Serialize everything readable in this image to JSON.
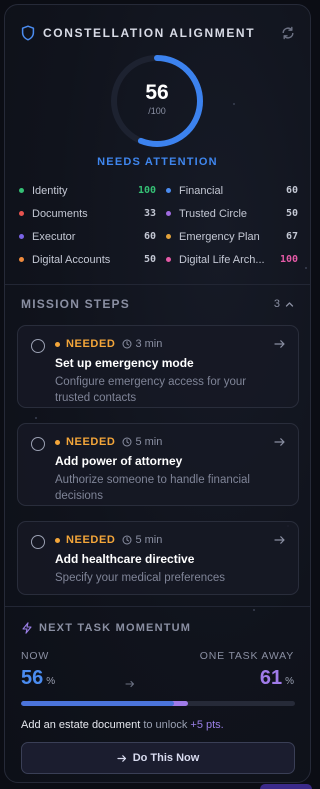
{
  "header": {
    "title": "CONSTELLATION ALIGNMENT",
    "icon": "shield-icon",
    "refresh_icon": "refresh-icon"
  },
  "score": {
    "value": "56",
    "out_of": "/100",
    "fraction": 0.56,
    "status": "NEEDS ATTENTION",
    "color": "#3f86ee"
  },
  "categories": [
    {
      "name": "Identity",
      "value": "100",
      "dot": "#35c075",
      "value_color": "#35c075"
    },
    {
      "name": "Financial",
      "value": "60",
      "dot": "#4b8cf0",
      "value_color": "#c3c7d3"
    },
    {
      "name": "Documents",
      "value": "33",
      "dot": "#e8534f",
      "value_color": "#c3c7d3"
    },
    {
      "name": "Trusted Circle",
      "value": "50",
      "dot": "#a06be0",
      "value_color": "#c3c7d3"
    },
    {
      "name": "Executor",
      "value": "60",
      "dot": "#7a63e6",
      "value_color": "#c3c7d3"
    },
    {
      "name": "Emergency Plan",
      "value": "67",
      "dot": "#e3a23b",
      "value_color": "#c3c7d3"
    },
    {
      "name": "Digital Accounts",
      "value": "50",
      "dot": "#ef8a3c",
      "value_color": "#c3c7d3"
    },
    {
      "name": "Digital Life Arch...",
      "value": "100",
      "dot": "#e55aa7",
      "value_color": "#e55aa7"
    }
  ],
  "mission": {
    "label": "MISSION STEPS",
    "count": "3"
  },
  "steps": [
    {
      "status": "NEEDED",
      "time": "3 min",
      "title": "Set up emergency mode",
      "desc": "Configure emergency access for your trusted contacts"
    },
    {
      "status": "NEEDED",
      "time": "5 min",
      "title": "Add power of attorney",
      "desc": "Authorize someone to handle financial decisions"
    },
    {
      "status": "NEEDED",
      "time": "5 min",
      "title": "Add healthcare directive",
      "desc": "Specify your medical preferences"
    }
  ],
  "momentum": {
    "label": "NEXT TASK MOMENTUM",
    "now_label": "NOW",
    "away_label": "ONE TASK AWAY",
    "now_value": "56",
    "away_value": "61",
    "pct": "%",
    "now_fraction": 0.56,
    "away_fraction": 0.61,
    "unlock_strong": "Add an estate document",
    "unlock_mid": "to unlock",
    "unlock_pts": "+5 pts.",
    "cta_label": "Do This Now"
  }
}
